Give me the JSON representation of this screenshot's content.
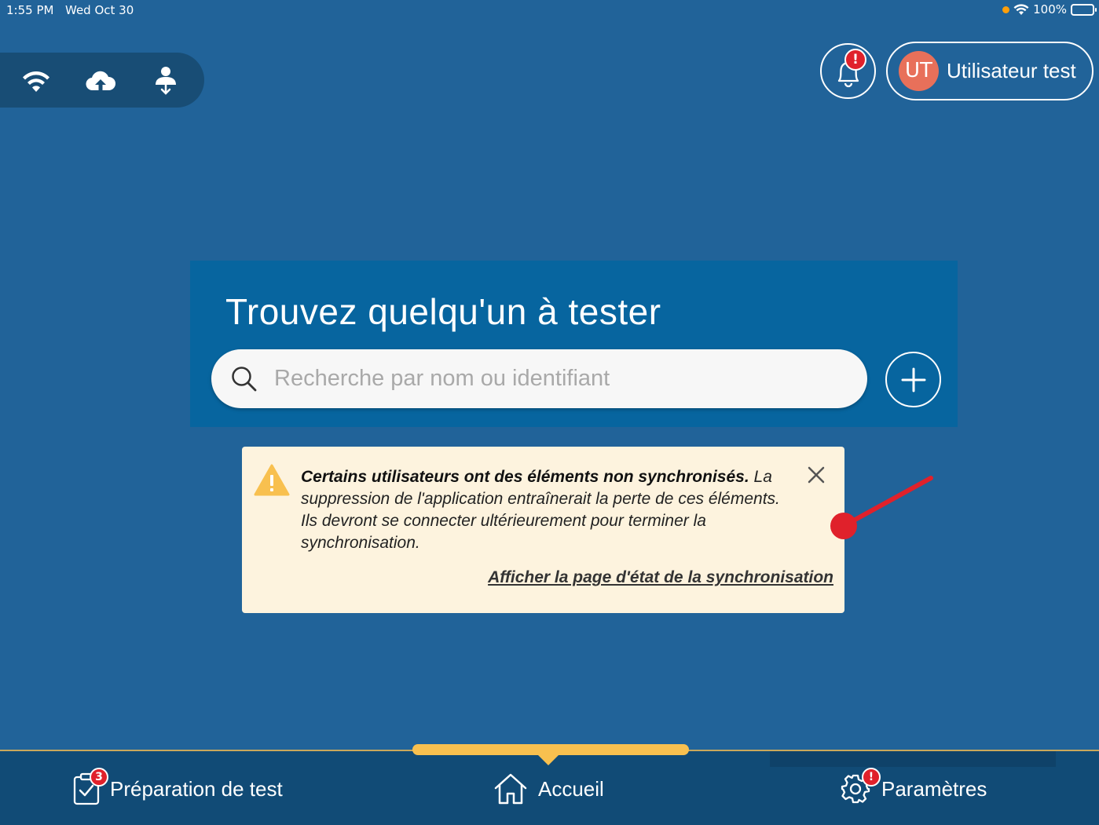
{
  "status_bar": {
    "time": "1:55 PM",
    "date": "Wed Oct 30",
    "battery": "100%"
  },
  "connection": {
    "icons": [
      "wifi-icon",
      "cloud-upload-icon",
      "user-sync-icon"
    ]
  },
  "header": {
    "notification_badge": "!",
    "user": {
      "initials": "UT",
      "name": "Utilisateur test",
      "avatar_color": "#e8705a"
    }
  },
  "search": {
    "title": "Trouvez quelqu'un à tester",
    "placeholder": "Recherche par nom ou identifiant"
  },
  "warning": {
    "bold": "Certains utilisateurs ont des éléments non synchronisés.",
    "body": "La suppression de l'application entraînerait la perte de ces éléments. Ils devront se connecter ultérieurement pour terminer la synchronisation.",
    "link": "Afficher la page d'état de la synchronisation"
  },
  "tabs": [
    {
      "label": "Préparation de test",
      "badge": "3"
    },
    {
      "label": "Accueil",
      "badge": ""
    },
    {
      "label": "Paramètres",
      "badge": "!"
    }
  ],
  "colors": {
    "background": "#216399",
    "card": "#07659f",
    "tab_bar": "#114b76",
    "accent": "#f8c04f",
    "badge": "#e0212b",
    "warning_bg": "#fdf3de"
  }
}
